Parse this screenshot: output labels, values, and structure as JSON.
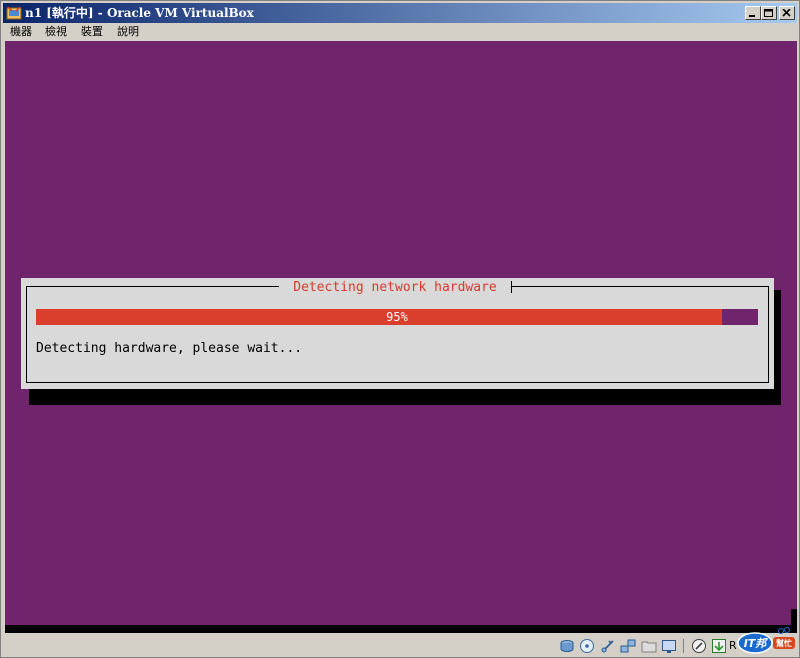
{
  "window": {
    "title": "n1 [執行中] - Oracle VM VirtualBox"
  },
  "menu": {
    "items": [
      "機器",
      "檢視",
      "裝置",
      "說明"
    ]
  },
  "dialog": {
    "title": "Detecting network hardware",
    "progress_percent": 95,
    "progress_label": "95%",
    "status": "Detecting hardware, please wait..."
  },
  "statusbar": {
    "icons": [
      "hard-disk-icon",
      "optical-drive-icon",
      "usb-icon",
      "network-icon",
      "shared-folder-icon",
      "display-icon",
      "virtualization-icon",
      "mouse-integration-icon"
    ],
    "host_key_fragment": "R"
  },
  "colors": {
    "screen_bg": "#6f246c",
    "progress_fill": "#da3f2e",
    "dialog_bg": "#d9d9d9",
    "dialog_title": "#d63a2c",
    "titlebar_start": "#0a246a",
    "titlebar_end": "#a6caf0"
  }
}
